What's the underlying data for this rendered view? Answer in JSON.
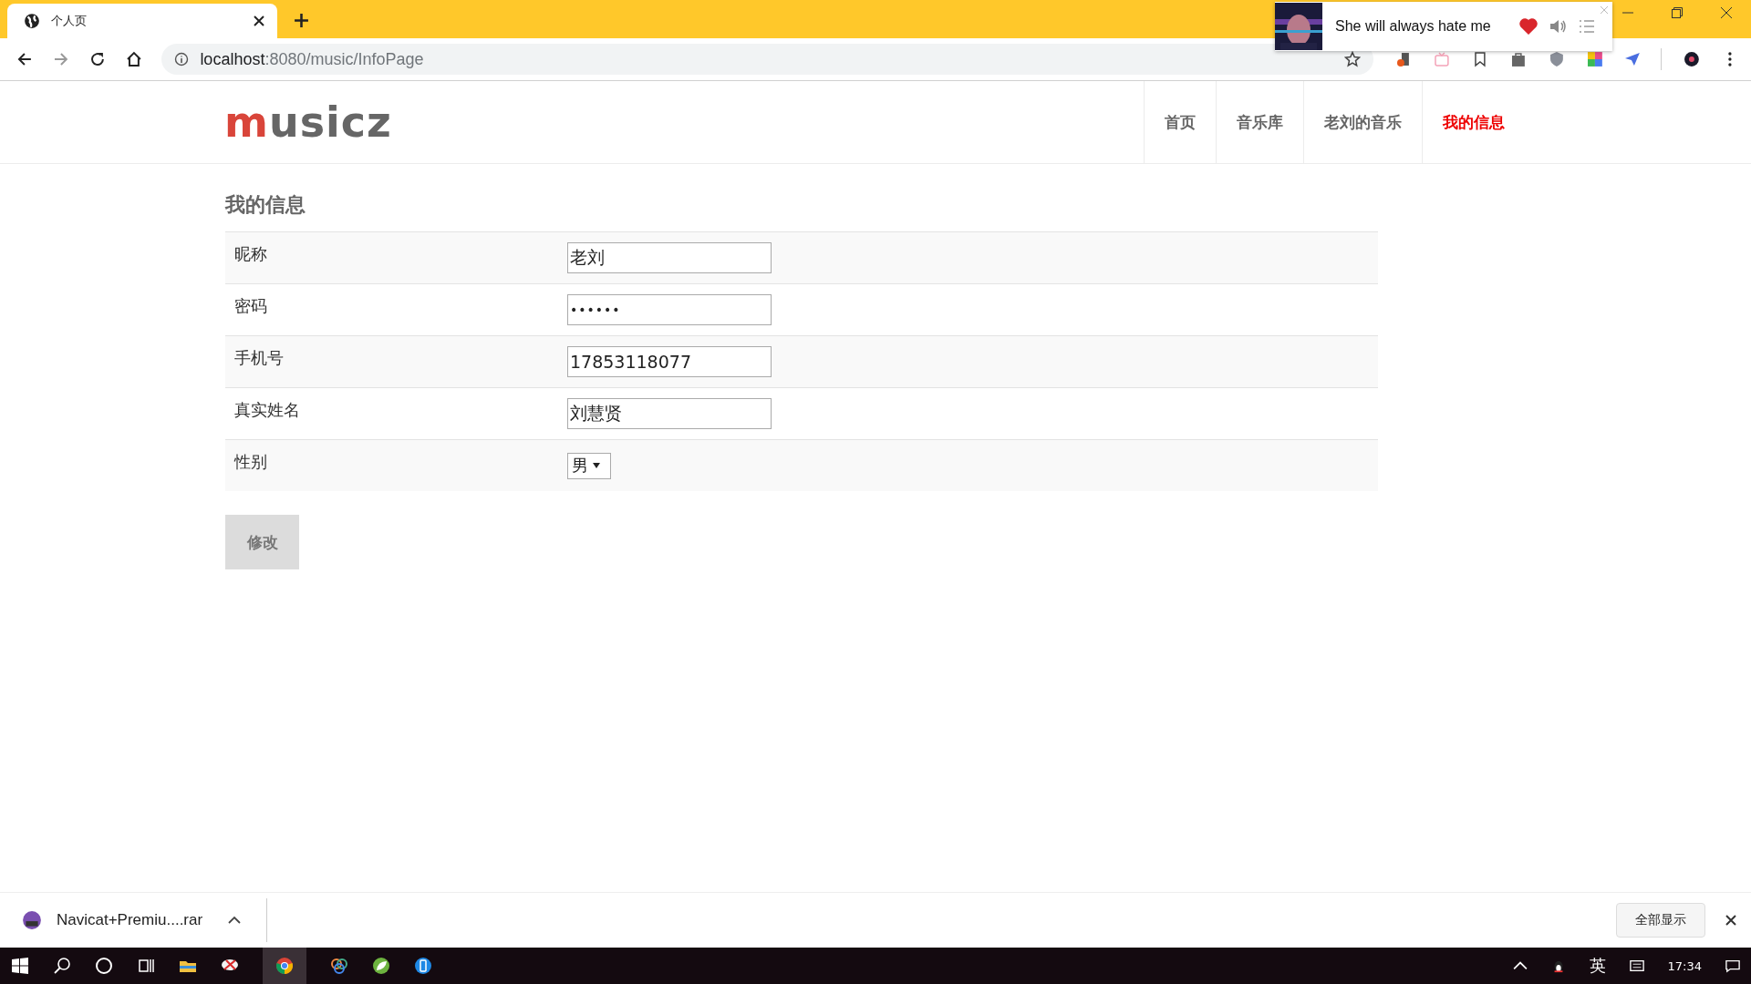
{
  "browser": {
    "tab": {
      "title": "个人页"
    },
    "address": {
      "host": "localhost",
      "path": ":8080/music/InfoPage"
    }
  },
  "music_popup": {
    "song": "She will always hate me",
    "liked": true
  },
  "site": {
    "logo": {
      "first": "m",
      "rest": "usicz"
    },
    "nav": [
      {
        "label": "首页",
        "selected": false
      },
      {
        "label": "音乐库",
        "selected": false
      },
      {
        "label": "老刘的音乐",
        "selected": false
      },
      {
        "label": "我的信息",
        "selected": true
      }
    ]
  },
  "page": {
    "title": "我的信息",
    "fields": [
      {
        "label": "昵称",
        "kind": "text",
        "value": "老刘"
      },
      {
        "label": "密码",
        "kind": "password",
        "value": "••••••"
      },
      {
        "label": "手机号",
        "kind": "text",
        "value": "17853118077"
      },
      {
        "label": "真实姓名",
        "kind": "text",
        "value": "刘慧贤"
      },
      {
        "label": "性别",
        "kind": "select",
        "value": "男"
      }
    ],
    "submit": "修改"
  },
  "downloads": {
    "file": "Navicat+Premiu....rar",
    "show_all": "全部显示"
  },
  "taskbar": {
    "ime": "英",
    "time": "17:34"
  }
}
